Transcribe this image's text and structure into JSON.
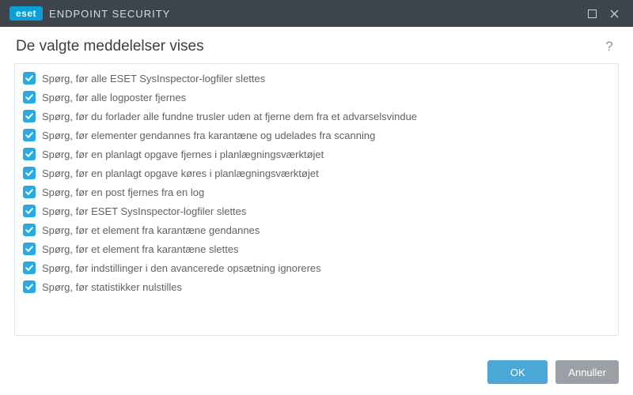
{
  "titlebar": {
    "brand_badge": "eset",
    "brand_text": "ENDPOINT SECURITY"
  },
  "header": {
    "title": "De valgte meddelelser vises",
    "help_symbol": "?"
  },
  "items": [
    {
      "checked": true,
      "label": "Spørg, før alle ESET SysInspector-logfiler slettes"
    },
    {
      "checked": true,
      "label": "Spørg, før alle logposter fjernes"
    },
    {
      "checked": true,
      "label": "Spørg, før du forlader alle fundne trusler uden at fjerne dem fra et advarselsvindue"
    },
    {
      "checked": true,
      "label": "Spørg, før elementer gendannes fra karantæne og udelades fra scanning"
    },
    {
      "checked": true,
      "label": "Spørg, før en planlagt opgave fjernes i planlægningsværktøjet"
    },
    {
      "checked": true,
      "label": "Spørg, før en planlagt opgave køres i planlægningsværktøjet"
    },
    {
      "checked": true,
      "label": "Spørg, før en post fjernes fra en log"
    },
    {
      "checked": true,
      "label": "Spørg, før ESET SysInspector-logfiler slettes"
    },
    {
      "checked": true,
      "label": "Spørg, før et element fra karantæne gendannes"
    },
    {
      "checked": true,
      "label": "Spørg, før et element fra karantæne slettes"
    },
    {
      "checked": true,
      "label": "Spørg, før indstillinger i den avancerede opsætning ignoreres"
    },
    {
      "checked": true,
      "label": "Spørg, før statistikker nulstilles"
    }
  ],
  "footer": {
    "ok_label": "OK",
    "cancel_label": "Annuller"
  },
  "colors": {
    "accent": "#29abe2",
    "primary_btn": "#4aa7d6",
    "secondary_btn": "#9aa0a6",
    "titlebar_bg": "#3d444c"
  }
}
